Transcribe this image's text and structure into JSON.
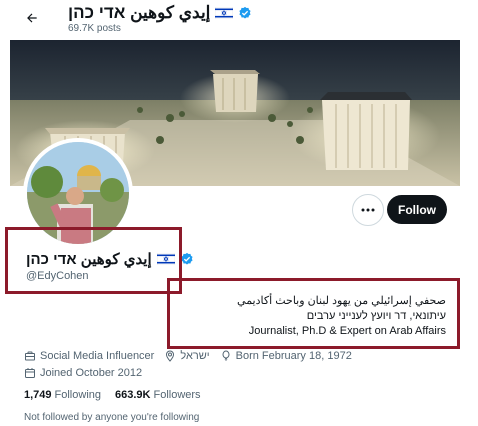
{
  "header": {
    "display_name": "إيدي كوهين אדי כהן",
    "posts_count": "69.7K posts"
  },
  "profile": {
    "display_name": "إيدي كوهين אדי כהן",
    "handle": "@EdyCohen",
    "follow_label": "Follow",
    "bio_lines": [
      "صحفي إسرائيلي من يهود لبنان وباحث أكاديمي",
      "עיתונאי, דר ויועץ לענייני ערבים",
      "Journalist, Ph.D & Expert on Arab Affairs"
    ]
  },
  "meta": {
    "category": "Social Media Influencer",
    "location": "ישראל",
    "born": "Born February 18, 1972",
    "joined": "Joined October 2012"
  },
  "stats": {
    "following_count": "1,749",
    "following_label": "Following",
    "followers_count": "663.9K",
    "followers_label": "Followers"
  },
  "not_followed_text": "Not followed by anyone you're following",
  "colors": {
    "verified": "#1d9bf0",
    "annotation_box": "#8c1a2a",
    "follow_button": "#0f1419",
    "muted_text": "#536471"
  },
  "icons": [
    "back-arrow-icon",
    "israel-flag-icon",
    "verified-badge-icon",
    "more-icon",
    "briefcase-icon",
    "location-icon",
    "balloon-icon",
    "calendar-icon"
  ]
}
